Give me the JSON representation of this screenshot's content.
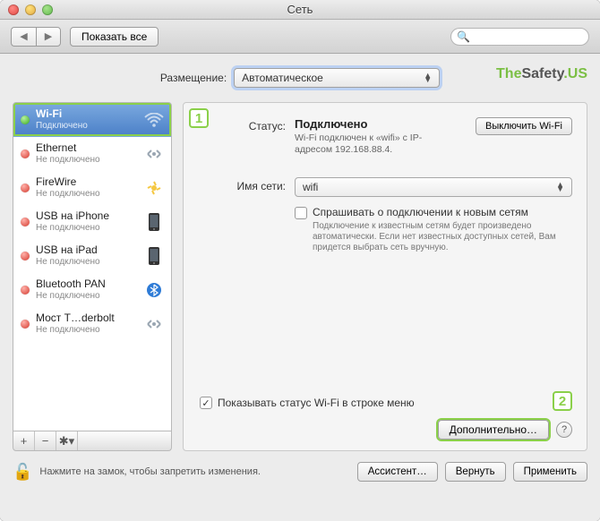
{
  "window": {
    "title": "Сеть"
  },
  "toolbar": {
    "show_all": "Показать все",
    "search_placeholder": ""
  },
  "location": {
    "label": "Размещение:",
    "value": "Автоматическое"
  },
  "watermark": {
    "pre": "The",
    "mid": "Safety",
    "suf": ".US"
  },
  "sidebar": {
    "items": [
      {
        "name": "Wi-Fi",
        "status": "Подключено",
        "led": "green",
        "icon": "wifi",
        "selected": true
      },
      {
        "name": "Ethernet",
        "status": "Не подключено",
        "led": "red",
        "icon": "ethernet"
      },
      {
        "name": "FireWire",
        "status": "Не подключено",
        "led": "red",
        "icon": "firewire"
      },
      {
        "name": "USB на iPhone",
        "status": "Не подключено",
        "led": "red",
        "icon": "iphone"
      },
      {
        "name": "USB на iPad",
        "status": "Не подключено",
        "led": "red",
        "icon": "iphone"
      },
      {
        "name": "Bluetooth PAN",
        "status": "Не подключено",
        "led": "red",
        "icon": "bluetooth"
      },
      {
        "name": "Мост T…derbolt",
        "status": "Не подключено",
        "led": "red",
        "icon": "ethernet"
      }
    ]
  },
  "detail": {
    "status_label": "Статус:",
    "status_value": "Подключено",
    "off_button": "Выключить Wi-Fi",
    "substatus": "Wi-Fi подключен к «wifi» с IP-адресом 192.168.88.4.",
    "network_label": "Имя сети:",
    "network_value": "wifi",
    "ask_label": "Спрашивать о подключении к новым сетям",
    "ask_help": "Подключение к известным сетям будет произведено автоматически. Если нет известных доступных сетей, Вам придется выбрать сеть вручную.",
    "show_status": "Показывать статус Wi-Fi в строке меню",
    "advanced": "Дополнительно…"
  },
  "badges": {
    "one": "1",
    "two": "2"
  },
  "footer": {
    "lock_text": "Нажмите на замок, чтобы запретить изменения.",
    "assist": "Ассистент…",
    "revert": "Вернуть",
    "apply": "Применить"
  }
}
